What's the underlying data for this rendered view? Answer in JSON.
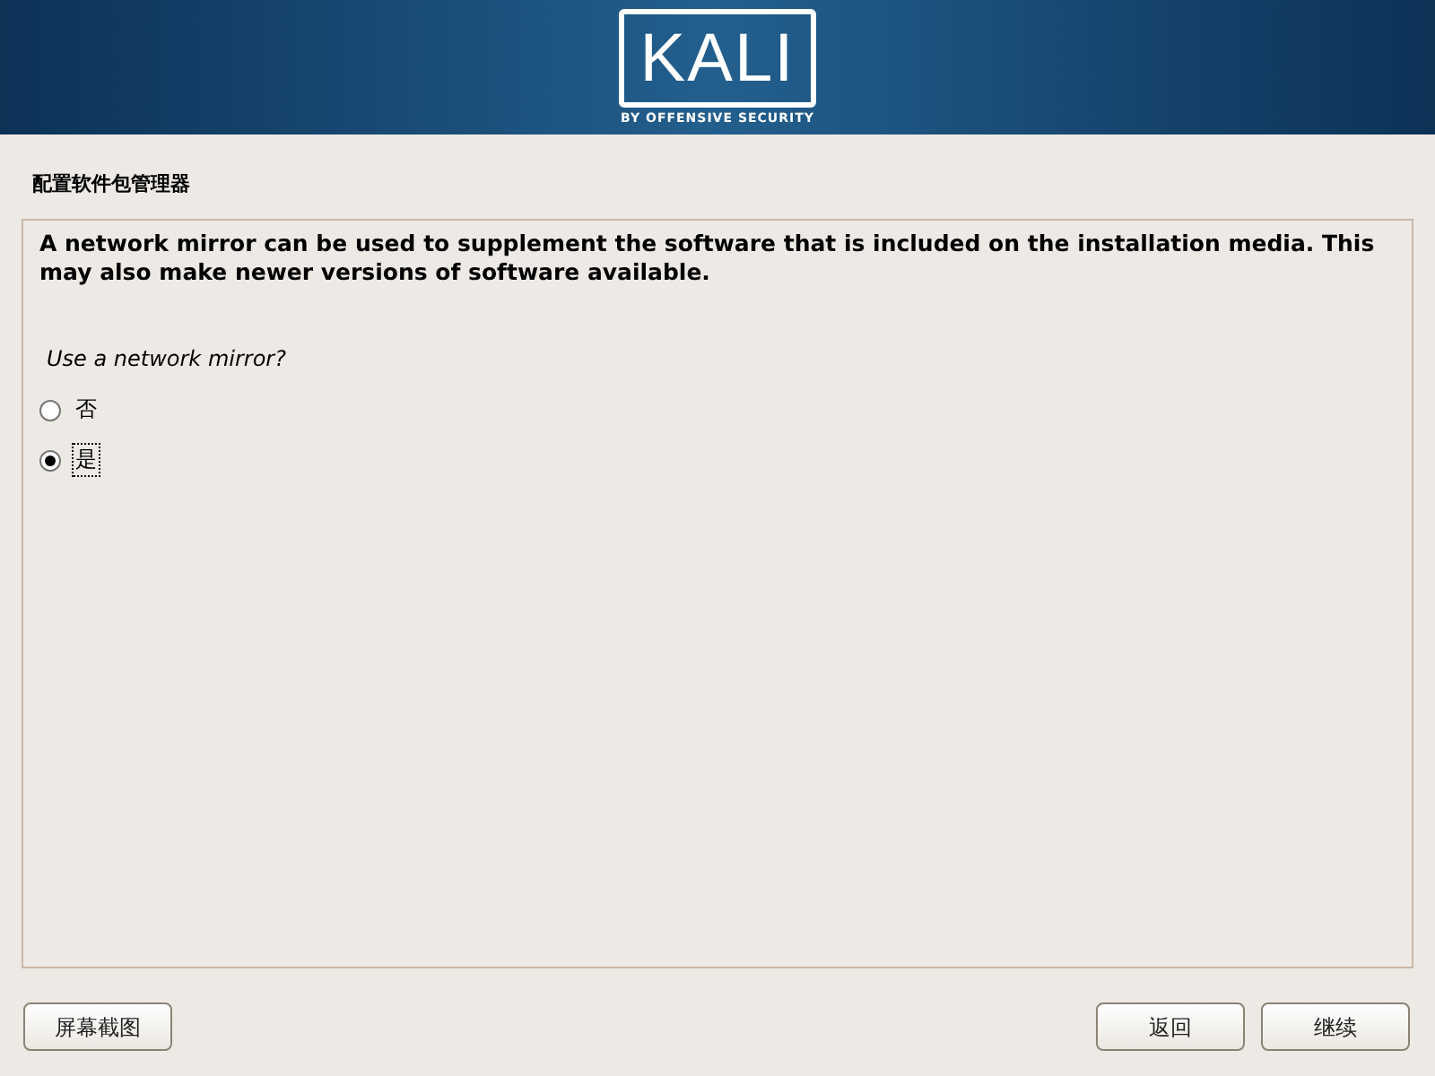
{
  "header": {
    "logo_text": "KALI",
    "tagline": "BY OFFENSIVE SECURITY"
  },
  "title": "配置软件包管理器",
  "description": "A network mirror can be used to supplement the software that is included on the installation media. This may also make newer versions of software available.",
  "question": "Use a network mirror?",
  "options": [
    {
      "label": "否",
      "selected": false,
      "focused": false
    },
    {
      "label": "是",
      "selected": true,
      "focused": true
    }
  ],
  "buttons": {
    "left": [
      {
        "label": "屏幕截图"
      }
    ],
    "right": [
      {
        "label": "返回"
      },
      {
        "label": "继续"
      }
    ]
  }
}
